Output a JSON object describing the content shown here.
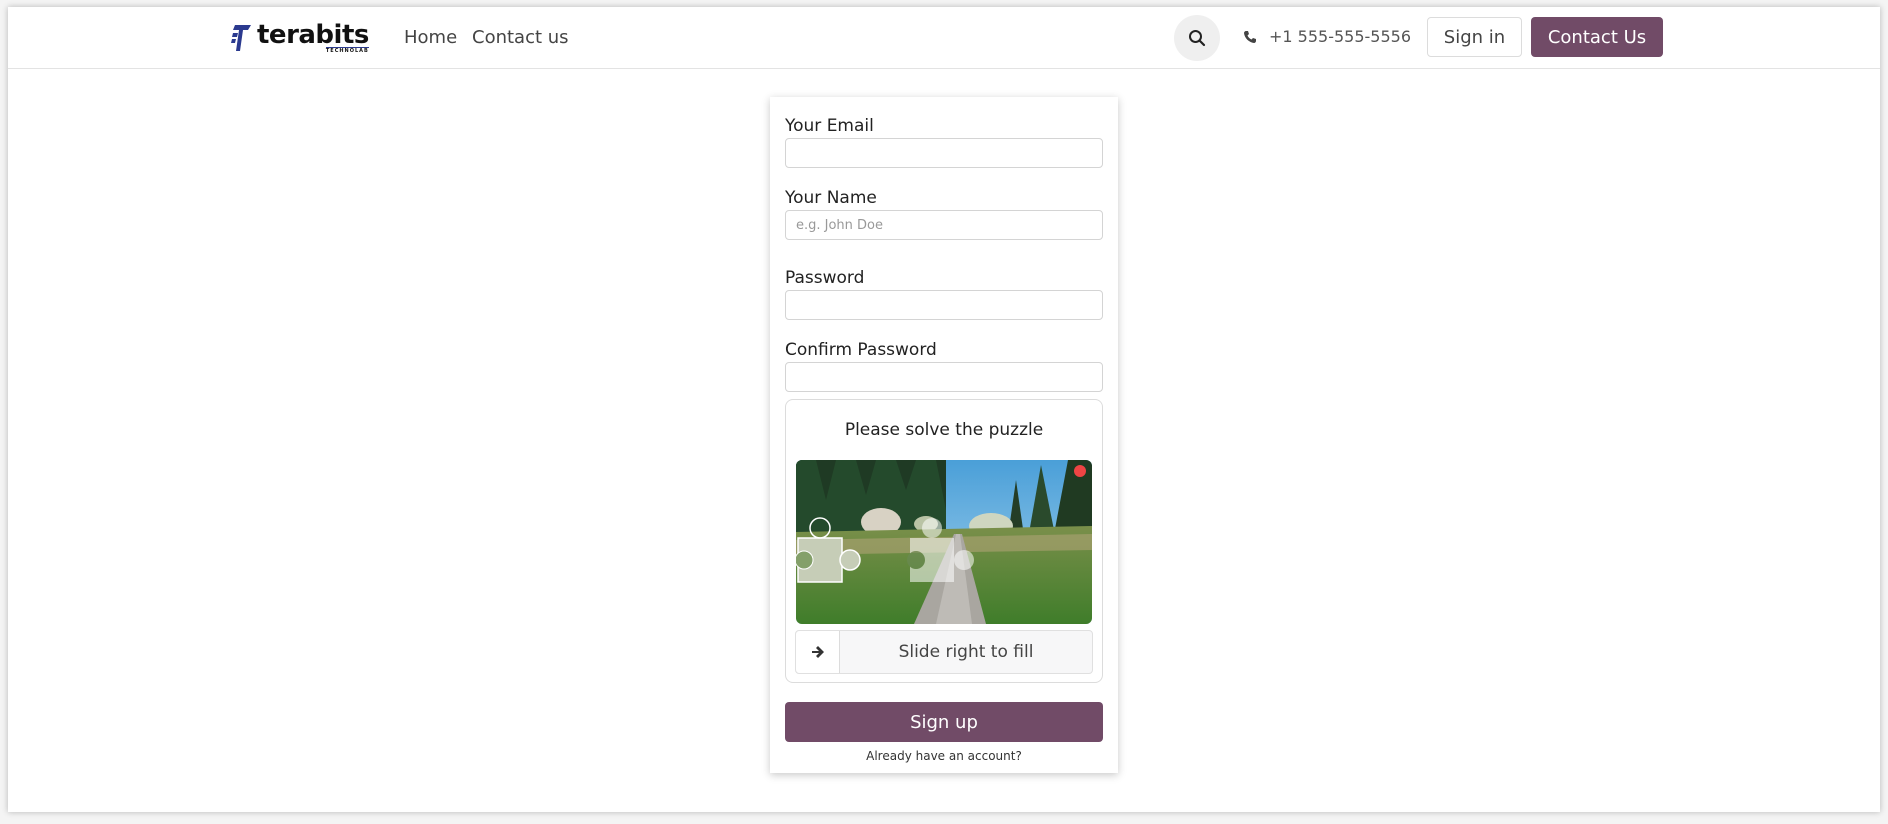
{
  "header": {
    "logo": {
      "word": "terabits",
      "sub": "TECHNOLAB"
    },
    "nav": [
      {
        "label": "Home"
      },
      {
        "label": "Contact us"
      }
    ],
    "phone": "+1 555-555-5556",
    "sign_in_label": "Sign in",
    "contact_button_label": "Contact Us"
  },
  "form": {
    "email": {
      "label": "Your Email",
      "value": "",
      "placeholder": ""
    },
    "name": {
      "label": "Your Name",
      "value": "",
      "placeholder": "e.g. John Doe"
    },
    "password": {
      "label": "Password",
      "value": ""
    },
    "confirm_password": {
      "label": "Confirm Password",
      "value": ""
    },
    "puzzle": {
      "title": "Please solve the puzzle",
      "slider_text": "Slide right to fill",
      "slider_icon": "arrow-right-icon",
      "status_color": "#ef4444"
    },
    "signup_label": "Sign up",
    "already_account_label": "Already have an account?"
  },
  "colors": {
    "brand": "#714b67",
    "logo_blue": "#2b3a8f"
  }
}
